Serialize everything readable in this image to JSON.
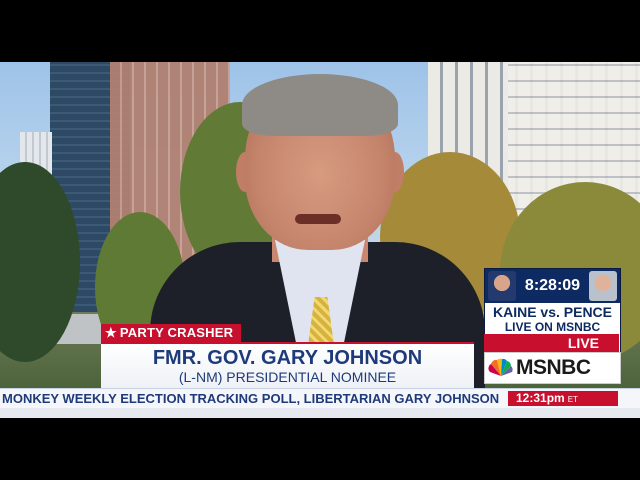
{
  "lower_third": {
    "tag": "PARTY CRASHER",
    "name": "FMR. GOV. GARY JOHNSON",
    "subtitle": "(L-NM) PRESIDENTIAL NOMINEE"
  },
  "promo": {
    "clock": "8:28:09",
    "headline": "KAINE vs. PENCE",
    "subhead": "LIVE ON MSNBC"
  },
  "live_label": "LIVE",
  "brand": "MSNBC",
  "ticker": {
    "text": "MONKEY WEEKLY ELECTION TRACKING POLL, LIBERTARIAN GARY JOHNSON",
    "time": "12:31pm",
    "timezone": "ET"
  },
  "colors": {
    "accent_red": "#c8102e",
    "navy": "#0e2a63",
    "ticker_text": "#1f3a7a"
  }
}
